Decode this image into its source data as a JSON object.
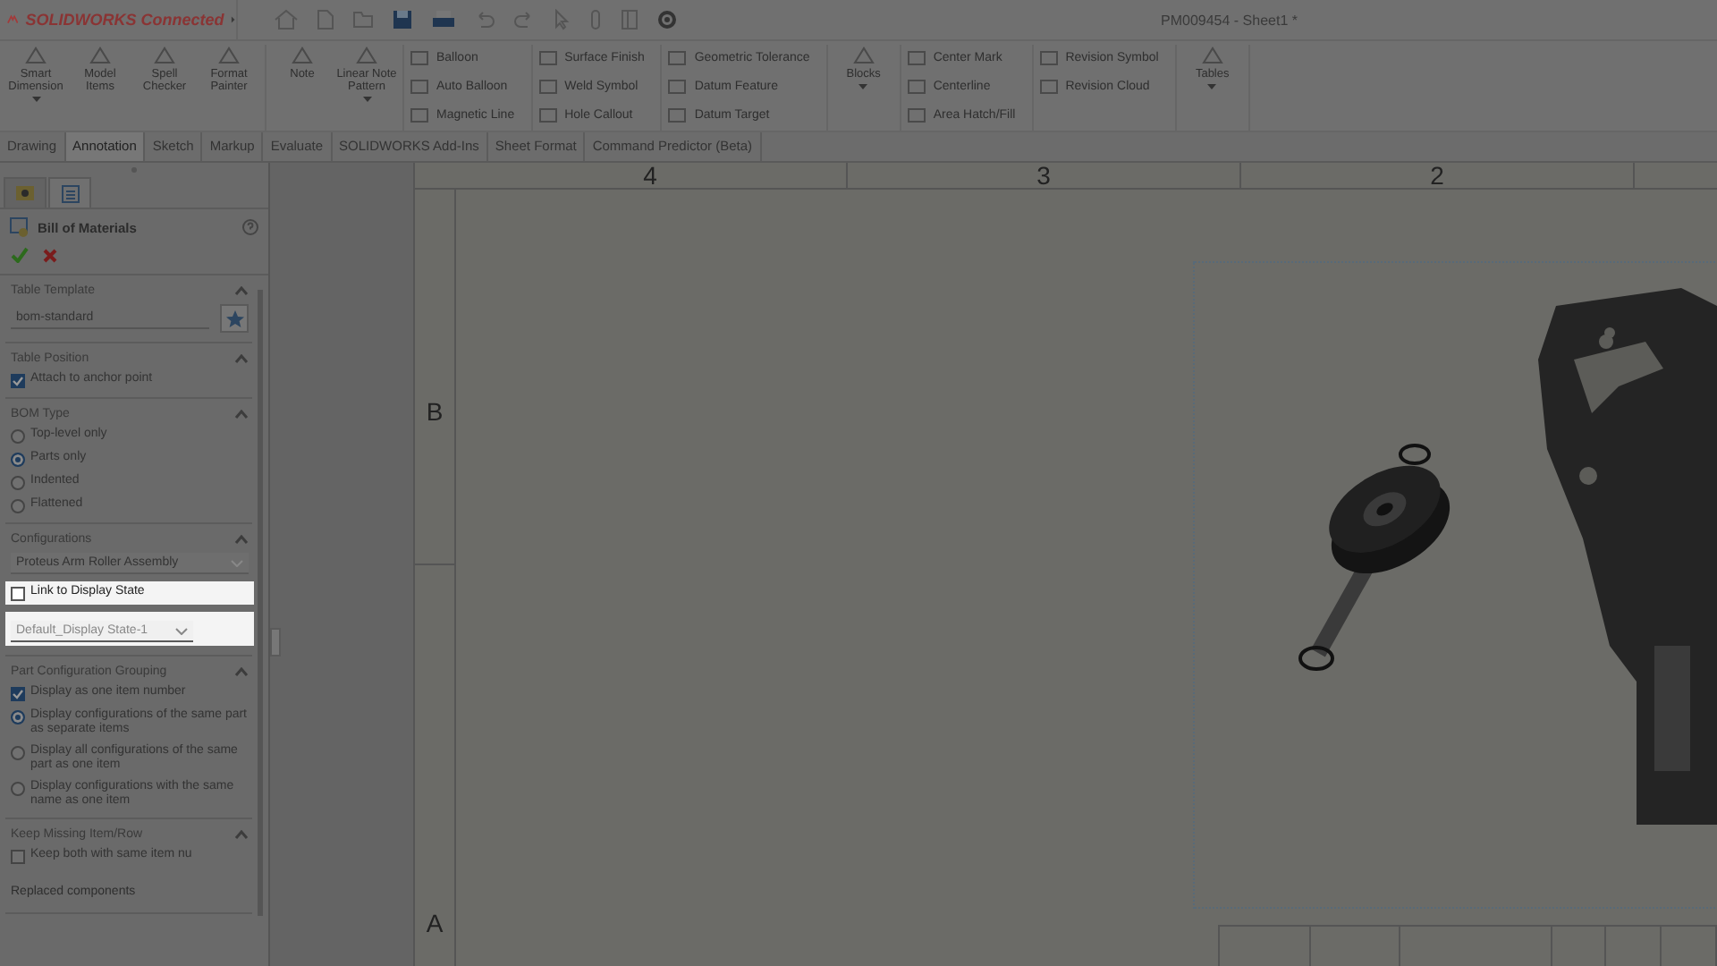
{
  "app": {
    "brand": "SOLIDWORKS Connected",
    "document_title": "PM009454 - Sheet1 *"
  },
  "ribbon": {
    "groups": [
      {
        "items": [
          {
            "label": "Smart Dimension",
            "kind": "large",
            "dropdown": true
          },
          {
            "label": "Model Items",
            "kind": "large",
            "dropdown": false
          },
          {
            "label": "Spell Checker",
            "kind": "large",
            "dropdown": false
          },
          {
            "label": "Format Painter",
            "kind": "large",
            "dropdown": false
          }
        ]
      },
      {
        "items": [
          {
            "label": "Note",
            "kind": "large",
            "dropdown": false
          },
          {
            "label": "Linear Note Pattern",
            "kind": "large",
            "dropdown": true
          }
        ]
      },
      {
        "items": [
          {
            "label": "Balloon",
            "kind": "small"
          },
          {
            "label": "Auto Balloon",
            "kind": "small"
          },
          {
            "label": "Magnetic Line",
            "kind": "small"
          }
        ]
      },
      {
        "items": [
          {
            "label": "Surface Finish",
            "kind": "small"
          },
          {
            "label": "Weld Symbol",
            "kind": "small"
          },
          {
            "label": "Hole Callout",
            "kind": "small"
          }
        ]
      },
      {
        "items": [
          {
            "label": "Geometric Tolerance",
            "kind": "small"
          },
          {
            "label": "Datum Feature",
            "kind": "small"
          },
          {
            "label": "Datum Target",
            "kind": "small"
          }
        ]
      },
      {
        "items": [
          {
            "label": "Blocks",
            "kind": "large",
            "dropdown": true
          }
        ]
      },
      {
        "items": [
          {
            "label": "Center Mark",
            "kind": "small"
          },
          {
            "label": "Centerline",
            "kind": "small"
          },
          {
            "label": "Area Hatch/Fill",
            "kind": "small"
          }
        ]
      },
      {
        "items": [
          {
            "label": "Revision Symbol",
            "kind": "small"
          },
          {
            "label": "Revision Cloud",
            "kind": "small"
          }
        ]
      },
      {
        "items": [
          {
            "label": "Tables",
            "kind": "large",
            "dropdown": true
          }
        ]
      }
    ]
  },
  "tabs": [
    {
      "label": "Drawing",
      "selected": false
    },
    {
      "label": "Annotation",
      "selected": true
    },
    {
      "label": "Sketch",
      "selected": false
    },
    {
      "label": "Markup",
      "selected": false
    },
    {
      "label": "Evaluate",
      "selected": false
    },
    {
      "label": "SOLIDWORKS Add-Ins",
      "selected": false
    },
    {
      "label": "Sheet Format",
      "selected": false
    },
    {
      "label": "Command Predictor (Beta)",
      "selected": false
    }
  ],
  "property_manager": {
    "panel_tabs": [
      {
        "selected": false
      },
      {
        "selected": true
      }
    ],
    "title": "Bill of Materials",
    "sections": [
      {
        "title": "Table Template",
        "items": [
          {
            "kind": "field",
            "value": "bom-standard"
          }
        ]
      },
      {
        "title": "Table Position",
        "items": [
          {
            "kind": "checkbox",
            "label": "Attach to anchor point",
            "checked": true
          }
        ]
      },
      {
        "title": "BOM Type",
        "items": [
          {
            "kind": "radio",
            "label": "Top-level only",
            "selected": false
          },
          {
            "kind": "radio",
            "label": "Parts only",
            "selected": true
          },
          {
            "kind": "radio",
            "label": "Indented",
            "selected": false
          },
          {
            "kind": "radio",
            "label": "Flattened",
            "selected": false
          }
        ]
      },
      {
        "title": "Configurations",
        "items": [
          {
            "kind": "dropdown",
            "value": "Proteus Arm Roller Assembly",
            "disabled": false,
            "highlighted": false
          },
          {
            "kind": "checkbox",
            "label": "Link to Display State",
            "checked": false,
            "highlighted": true
          },
          {
            "kind": "dropdown",
            "value": "Default_Display State-1",
            "disabled": true,
            "highlighted": true
          }
        ]
      },
      {
        "title": "Part Configuration Grouping",
        "items": [
          {
            "kind": "checkbox",
            "label": "Display as one item number",
            "checked": true
          },
          {
            "kind": "radio",
            "label": "Display configurations of the same part as separate items",
            "selected": true
          },
          {
            "kind": "radio",
            "label": "Display all configurations of the same part as one item",
            "selected": false
          },
          {
            "kind": "radio",
            "label": "Display configurations with the same name as one item",
            "selected": false
          }
        ]
      },
      {
        "title": "Keep Missing Item/Row",
        "items": [
          {
            "kind": "checkbox",
            "label": "Keep both with same item nu",
            "checked": false
          },
          {
            "kind": "note",
            "label": "Replaced components"
          }
        ]
      }
    ]
  },
  "sheet": {
    "column_zones": [
      "4",
      "3",
      "2"
    ],
    "row_zones": [
      "B",
      "A"
    ]
  }
}
